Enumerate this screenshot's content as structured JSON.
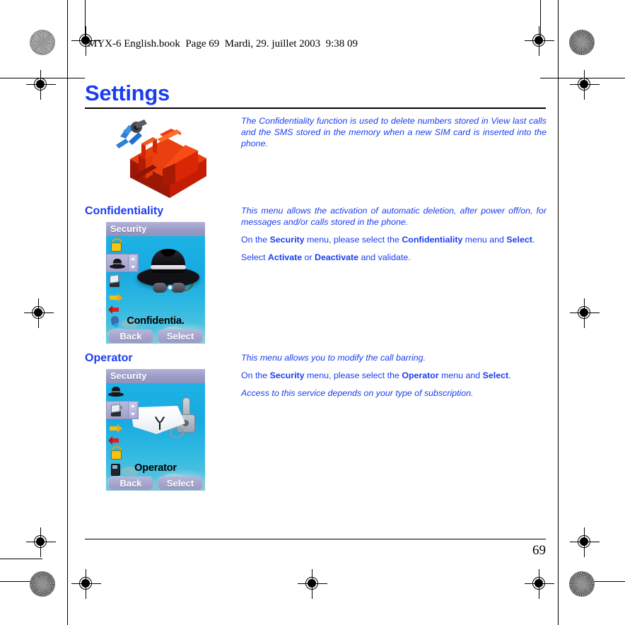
{
  "runhead": "MYX-6 English.book  Page 69  Mardi, 29. juillet 2003  9:38 09",
  "page_title": "Settings",
  "folio": "69",
  "colors": {
    "heading_blue": "#1a3df0",
    "body_blue": "#1a3df0",
    "phone_titlebar": "#9b9bc6",
    "phone_sea": "#1fb6e8",
    "softkey": "#a3a3cd",
    "toolbox_red": "#d81e05",
    "pliers_blue": "#1e6fd0"
  },
  "intro": {
    "icon_name": "toolbox-with-pliers-illustration",
    "text": "The Confidentiality function is used to delete numbers stored in View last calls and the SMS stored in the memory when a new SIM card is inserted into the phone."
  },
  "sections": [
    {
      "heading": "Confidentiality",
      "screen": {
        "title": "Security",
        "caption": "Confidentia.",
        "softkey_left": "Back",
        "softkey_right": "Select",
        "artwork": "black-fedora-hat-and-sunglasses",
        "rail_icons": [
          "padlock-icon",
          "fedora-hat-icon",
          "operator-flag-key-icon",
          "yellow-arrow-icon",
          "red-arrow-icon",
          "blue-pin-icon"
        ],
        "selected_rail_index": 1
      },
      "paragraphs": [
        {
          "style": "italic",
          "runs": [
            {
              "text": "This menu allows the activation of automatic deletion, after power off/on, for messages and/or calls stored in the phone.",
              "bold": false
            }
          ]
        },
        {
          "style": "normal",
          "runs": [
            {
              "text": "On the ",
              "bold": false
            },
            {
              "text": "Security",
              "bold": true
            },
            {
              "text": " menu, please select the ",
              "bold": false
            },
            {
              "text": "Confidentiality",
              "bold": true
            },
            {
              "text": " menu and ",
              "bold": false
            },
            {
              "text": "Select",
              "bold": true
            },
            {
              "text": ".",
              "bold": false
            }
          ]
        },
        {
          "style": "normal",
          "runs": [
            {
              "text": "Select ",
              "bold": false
            },
            {
              "text": "Activate",
              "bold": true
            },
            {
              "text": " or ",
              "bold": false
            },
            {
              "text": "Deactivate",
              "bold": true
            },
            {
              "text": " and validate.",
              "bold": false
            }
          ]
        }
      ]
    },
    {
      "heading": "Operator",
      "screen": {
        "title": "Security",
        "caption": "Operator",
        "softkey_left": "Back",
        "softkey_right": "Select",
        "artwork": "white-flag-and-key",
        "rail_icons": [
          "fedora-hat-icon",
          "operator-flag-key-icon",
          "yellow-arrow-icon",
          "red-arrow-icon",
          "padlock-icon",
          "phone-icon"
        ],
        "selected_rail_index": 1
      },
      "paragraphs": [
        {
          "style": "italic",
          "runs": [
            {
              "text": "This menu allows you to modify the call barring.",
              "bold": false
            }
          ]
        },
        {
          "style": "normal",
          "runs": [
            {
              "text": "On the ",
              "bold": false
            },
            {
              "text": "Security",
              "bold": true
            },
            {
              "text": " menu, please select the ",
              "bold": false
            },
            {
              "text": "Operator",
              "bold": true
            },
            {
              "text": " menu and ",
              "bold": false
            },
            {
              "text": "Select",
              "bold": true
            },
            {
              "text": ".",
              "bold": false
            }
          ]
        },
        {
          "style": "italic",
          "runs": [
            {
              "text": "Access to this service depends on your type of subscription.",
              "bold": false
            }
          ]
        }
      ]
    }
  ]
}
